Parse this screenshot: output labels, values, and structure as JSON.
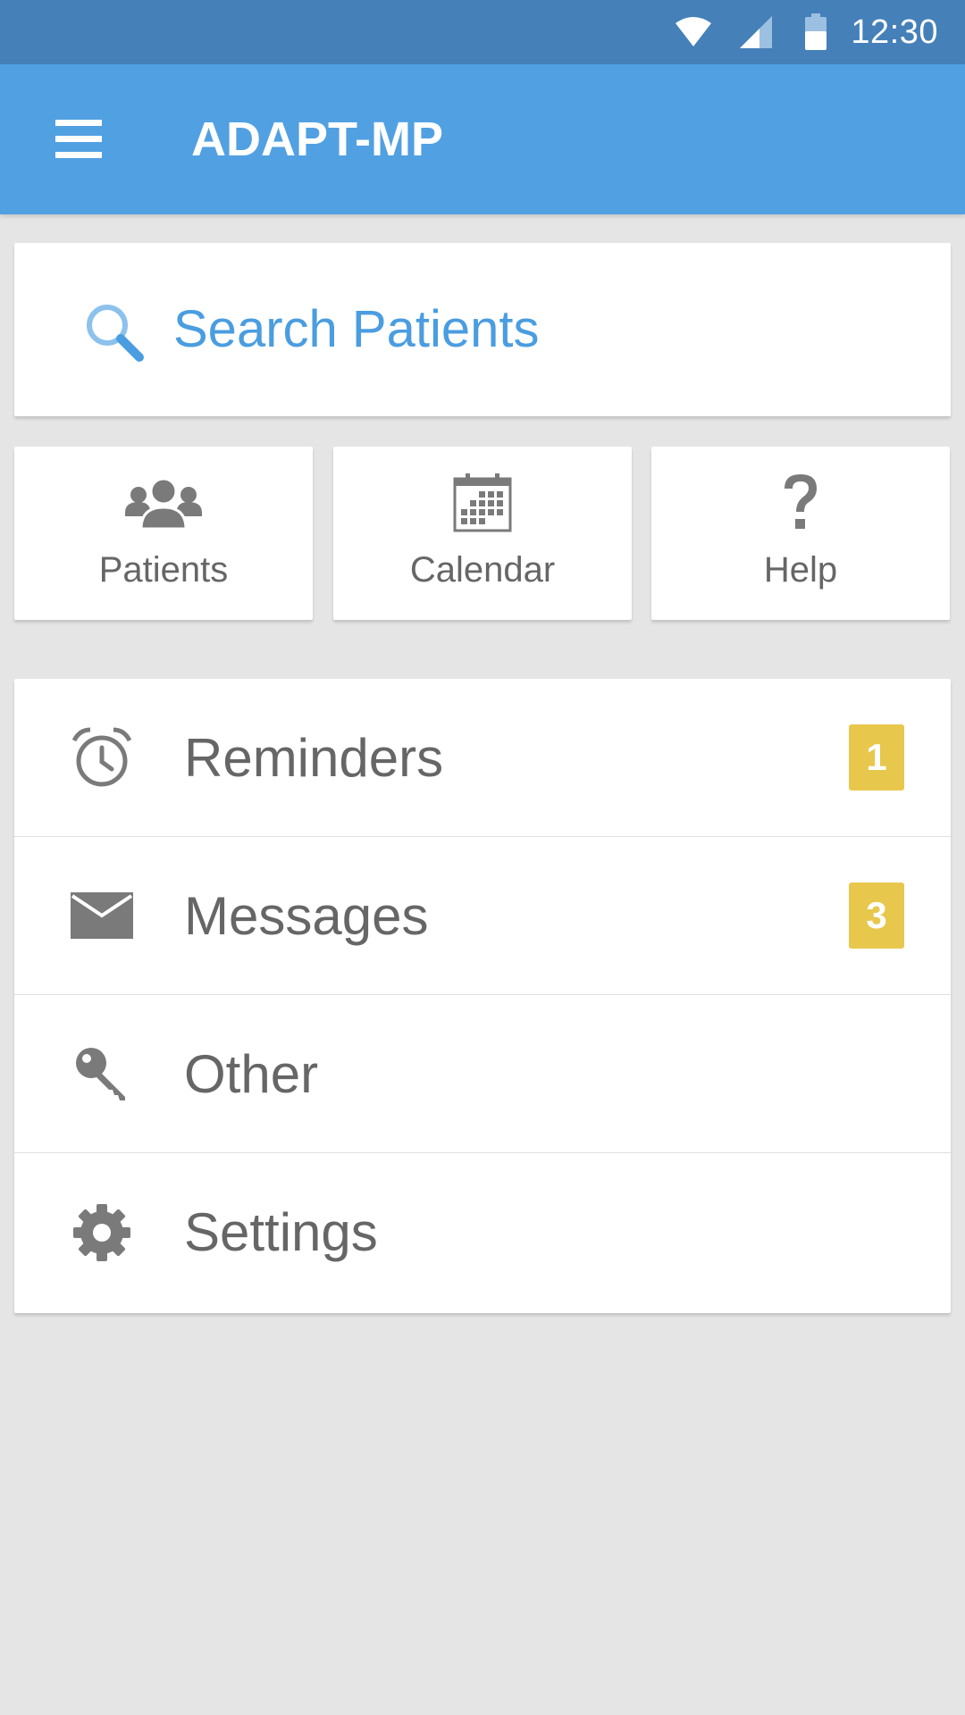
{
  "status_bar": {
    "time": "12:30"
  },
  "app_bar": {
    "title": "ADAPT-MP"
  },
  "search": {
    "placeholder": "Search Patients"
  },
  "tiles": [
    {
      "label": "Patients",
      "icon": "people-icon"
    },
    {
      "label": "Calendar",
      "icon": "calendar-icon"
    },
    {
      "label": "Help",
      "icon": "help-icon"
    }
  ],
  "menu": [
    {
      "label": "Reminders",
      "icon": "alarm-clock-icon",
      "badge": "1"
    },
    {
      "label": "Messages",
      "icon": "envelope-icon",
      "badge": "3"
    },
    {
      "label": "Other",
      "icon": "key-icon"
    },
    {
      "label": "Settings",
      "icon": "gear-icon"
    }
  ],
  "colors": {
    "status_bar": "#4580b8",
    "app_bar": "#51a0e2",
    "accent_text": "#4a9de0",
    "badge": "#e8c74d",
    "background": "#e5e5e5",
    "icon_gray": "#7a7a7a"
  }
}
